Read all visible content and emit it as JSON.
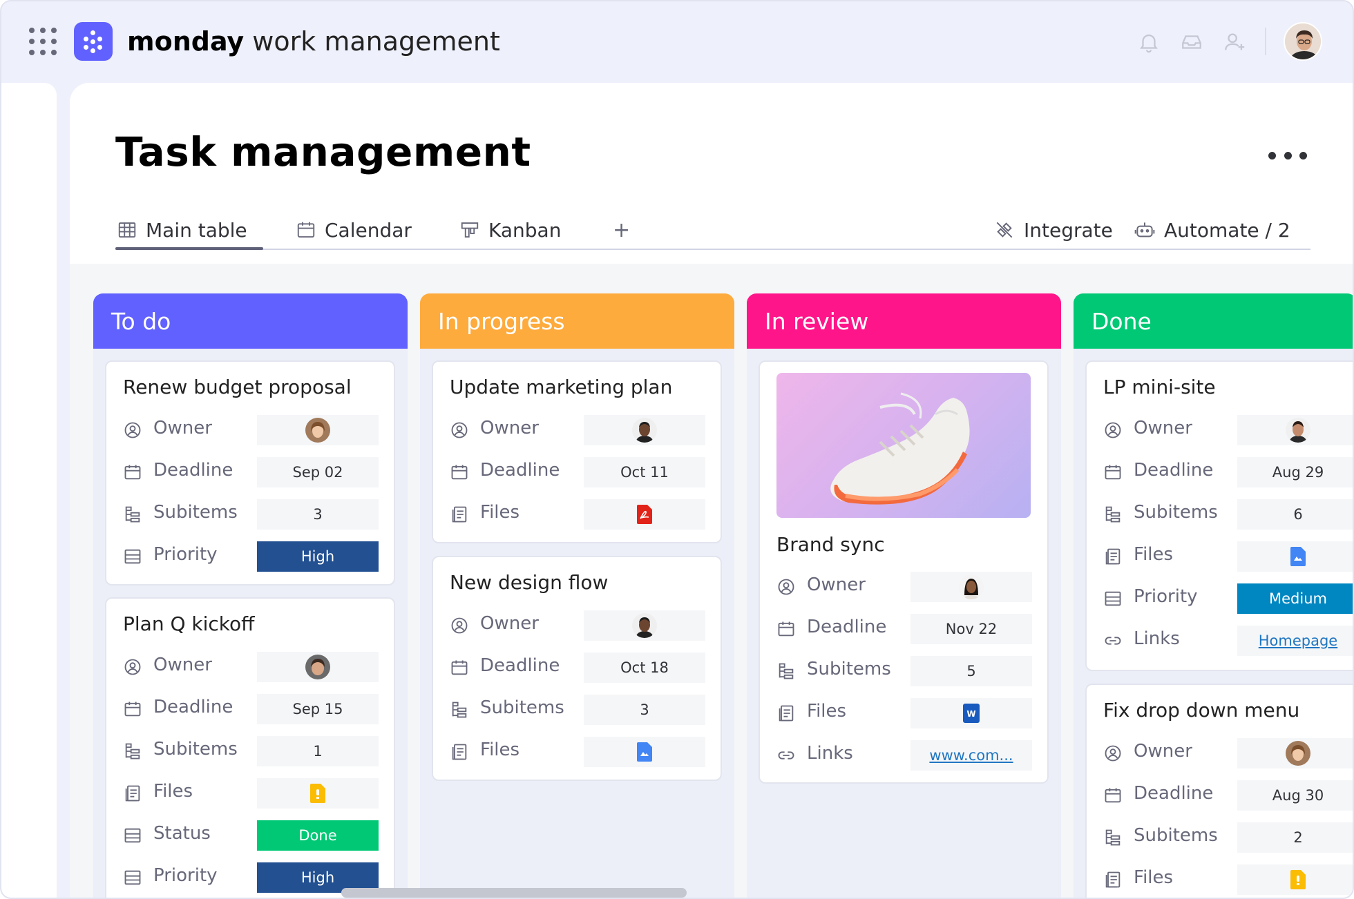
{
  "app": {
    "brand_bold": "monday",
    "brand_light": "work management"
  },
  "icons": {
    "apps": "apps-grid-icon",
    "logo": "monday-logo-icon",
    "bell": "bell-icon",
    "inbox": "inbox-icon",
    "invite": "invite-user-icon",
    "more": "more-options-icon"
  },
  "board": {
    "title": "Task management"
  },
  "tabs": [
    {
      "label": "Main table",
      "icon": "table-icon",
      "active": true
    },
    {
      "label": "Calendar",
      "icon": "calendar-icon",
      "active": false
    },
    {
      "label": "Kanban",
      "icon": "kanban-icon",
      "active": false
    },
    {
      "label": "+",
      "icon": "add-view-icon",
      "active": false
    }
  ],
  "actions": {
    "integrate": "Integrate",
    "automate": "Automate / 2"
  },
  "columns": [
    {
      "title": "To do",
      "color": "#6161ff",
      "cards": [
        {
          "title": "Renew budget proposal",
          "fields": [
            {
              "label": "Owner",
              "value": ""
            },
            {
              "label": "Deadline",
              "value": "Sep 02"
            },
            {
              "label": "Subitems",
              "value": "3"
            },
            {
              "label": "Priority",
              "value": "High"
            }
          ]
        },
        {
          "title": "Plan Q kickoff",
          "fields": [
            {
              "label": "Owner",
              "value": ""
            },
            {
              "label": "Deadline",
              "value": "Sep 15"
            },
            {
              "label": "Subitems",
              "value": "1"
            },
            {
              "label": "Files",
              "value": ""
            },
            {
              "label": "Status",
              "value": "Done"
            },
            {
              "label": "Priority",
              "value": "High"
            }
          ]
        }
      ]
    },
    {
      "title": "In progress",
      "color": "#fdab3d",
      "cards": [
        {
          "title": "Update marketing plan",
          "fields": [
            {
              "label": "Owner",
              "value": ""
            },
            {
              "label": "Deadline",
              "value": "Oct 11"
            },
            {
              "label": "Files",
              "value": ""
            }
          ]
        },
        {
          "title": "New design flow",
          "fields": [
            {
              "label": "Owner",
              "value": ""
            },
            {
              "label": "Deadline",
              "value": "Oct 18"
            },
            {
              "label": "Subitems",
              "value": "3"
            },
            {
              "label": "Files",
              "value": ""
            }
          ]
        }
      ]
    },
    {
      "title": "In review",
      "color": "#ff158a",
      "cards": [
        {
          "title": "Brand sync",
          "fields": [
            {
              "label": "Owner",
              "value": ""
            },
            {
              "label": "Deadline",
              "value": "Nov 22"
            },
            {
              "label": "Subitems",
              "value": "5"
            },
            {
              "label": "Files",
              "value": ""
            },
            {
              "label": "Links",
              "value": "www.com..."
            }
          ]
        }
      ]
    },
    {
      "title": "Done",
      "color": "#00c875",
      "cards": [
        {
          "title": "LP mini-site",
          "fields": [
            {
              "label": "Owner",
              "value": ""
            },
            {
              "label": "Deadline",
              "value": "Aug 29"
            },
            {
              "label": "Subitems",
              "value": "6"
            },
            {
              "label": "Files",
              "value": ""
            },
            {
              "label": "Priority",
              "value": "Medium"
            },
            {
              "label": "Links",
              "value": "Homepage"
            }
          ]
        },
        {
          "title": "Fix drop down menu",
          "fields": [
            {
              "label": "Owner",
              "value": ""
            },
            {
              "label": "Deadline",
              "value": "Aug 30"
            },
            {
              "label": "Subitems",
              "value": "2"
            },
            {
              "label": "Files",
              "value": ""
            }
          ]
        }
      ]
    }
  ],
  "colors": {
    "high": "#225091",
    "done": "#00c875",
    "medium": "#0086c0",
    "link": "#1f76c2"
  }
}
